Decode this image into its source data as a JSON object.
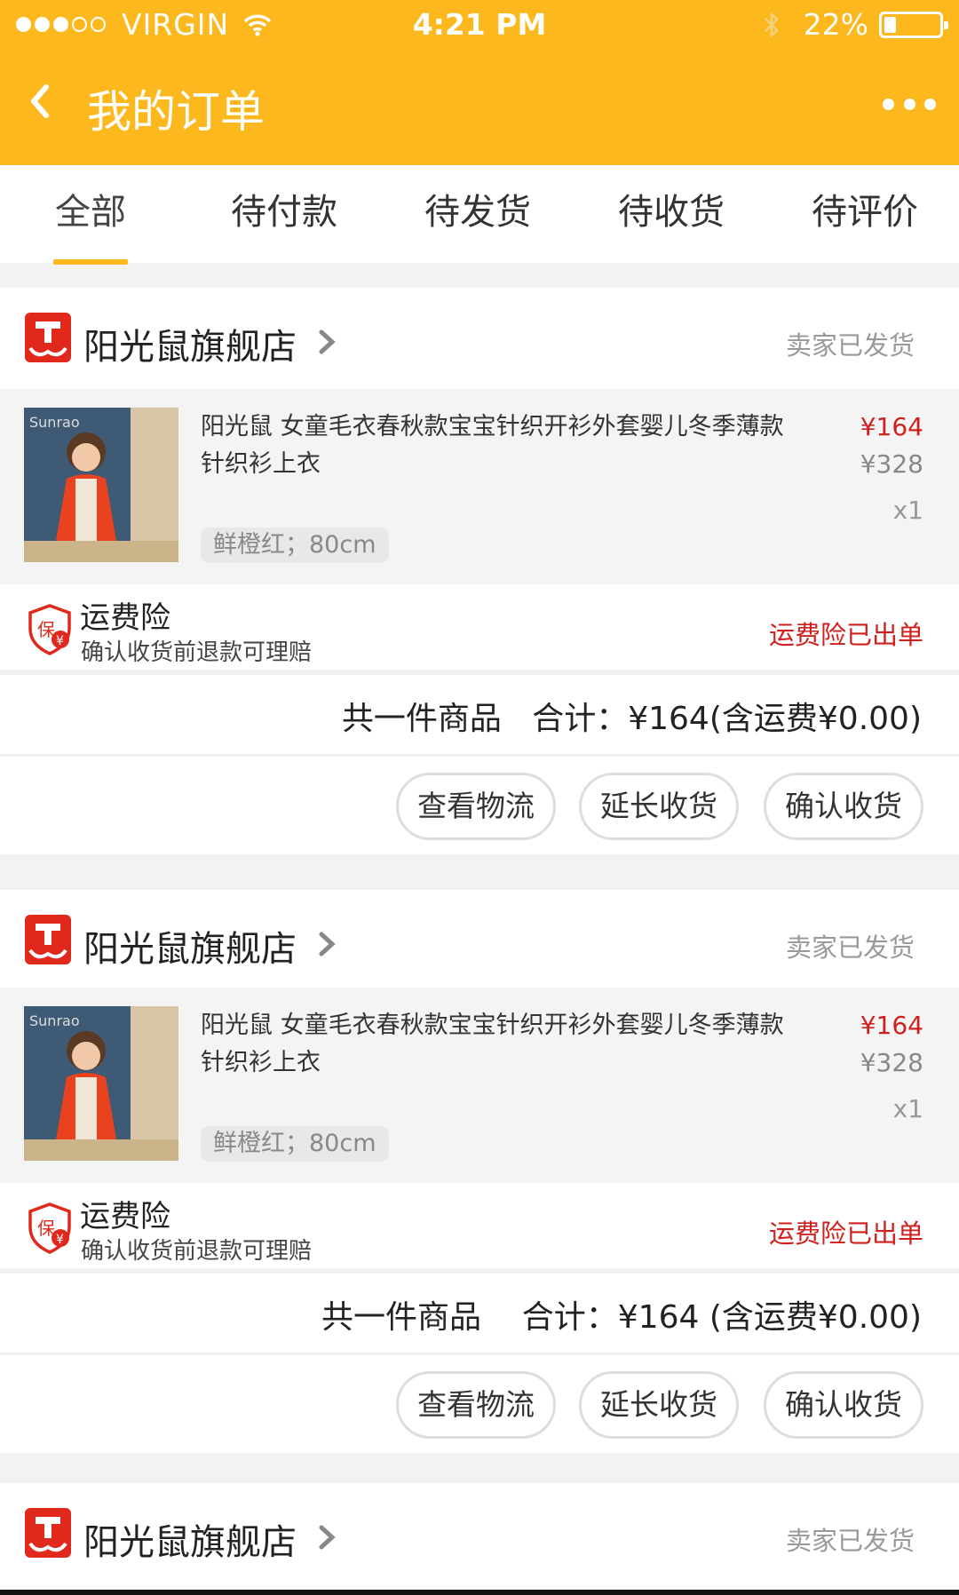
{
  "status_bar": {
    "carrier": "VIRGIN",
    "time": "4:21 PM",
    "battery": "22%",
    "battery_level": 0.22
  },
  "navbar": {
    "title": "我的订单"
  },
  "tabs": [
    {
      "label": "全部"
    },
    {
      "label": "待付款"
    },
    {
      "label": "待发货"
    },
    {
      "label": "待收货"
    },
    {
      "label": "待评价"
    }
  ],
  "colors": {
    "brand": "#fdb81e",
    "price": "#d0201d",
    "logo": "#e0281c"
  },
  "orders": [
    {
      "shop": "阳光鼠旗舰店",
      "status": "卖家已发货",
      "item_title": "阳光鼠 女童毛衣春秋款宝宝针织开衫外套婴儿冬季薄款针织衫上衣",
      "price": "¥164",
      "original_price": "¥328",
      "qty": "x1",
      "sku": "鲜橙红；80cm",
      "thumb_brand": "Sunrao",
      "insurance_title": "运费险",
      "insurance_sub": "确认收货前退款可理赔",
      "insurance_status": "运费险已出单",
      "insurance_badge": "保",
      "summary": "共一件商品   合计：¥164(含运费¥0.00)",
      "btn_logistics": "查看物流",
      "btn_extend": "延长收货",
      "btn_confirm": "确认收货"
    },
    {
      "shop": "阳光鼠旗舰店",
      "status": "卖家已发货",
      "item_title": "阳光鼠 女童毛衣春秋款宝宝针织开衫外套婴儿冬季薄款针织衫上衣",
      "price": "¥164",
      "original_price": "¥328",
      "qty": "x1",
      "sku": "鲜橙红；80cm",
      "thumb_brand": "Sunrao",
      "insurance_title": "运费险",
      "insurance_sub": "确认收货前退款可理赔",
      "insurance_status": "运费险已出单",
      "insurance_badge": "保",
      "summary": "共一件商品    合计：¥164 (含运费¥0.00)",
      "btn_logistics": "查看物流",
      "btn_extend": "延长收货",
      "btn_confirm": "确认收货"
    },
    {
      "shop": "阳光鼠旗舰店",
      "status": "卖家已发货"
    }
  ]
}
